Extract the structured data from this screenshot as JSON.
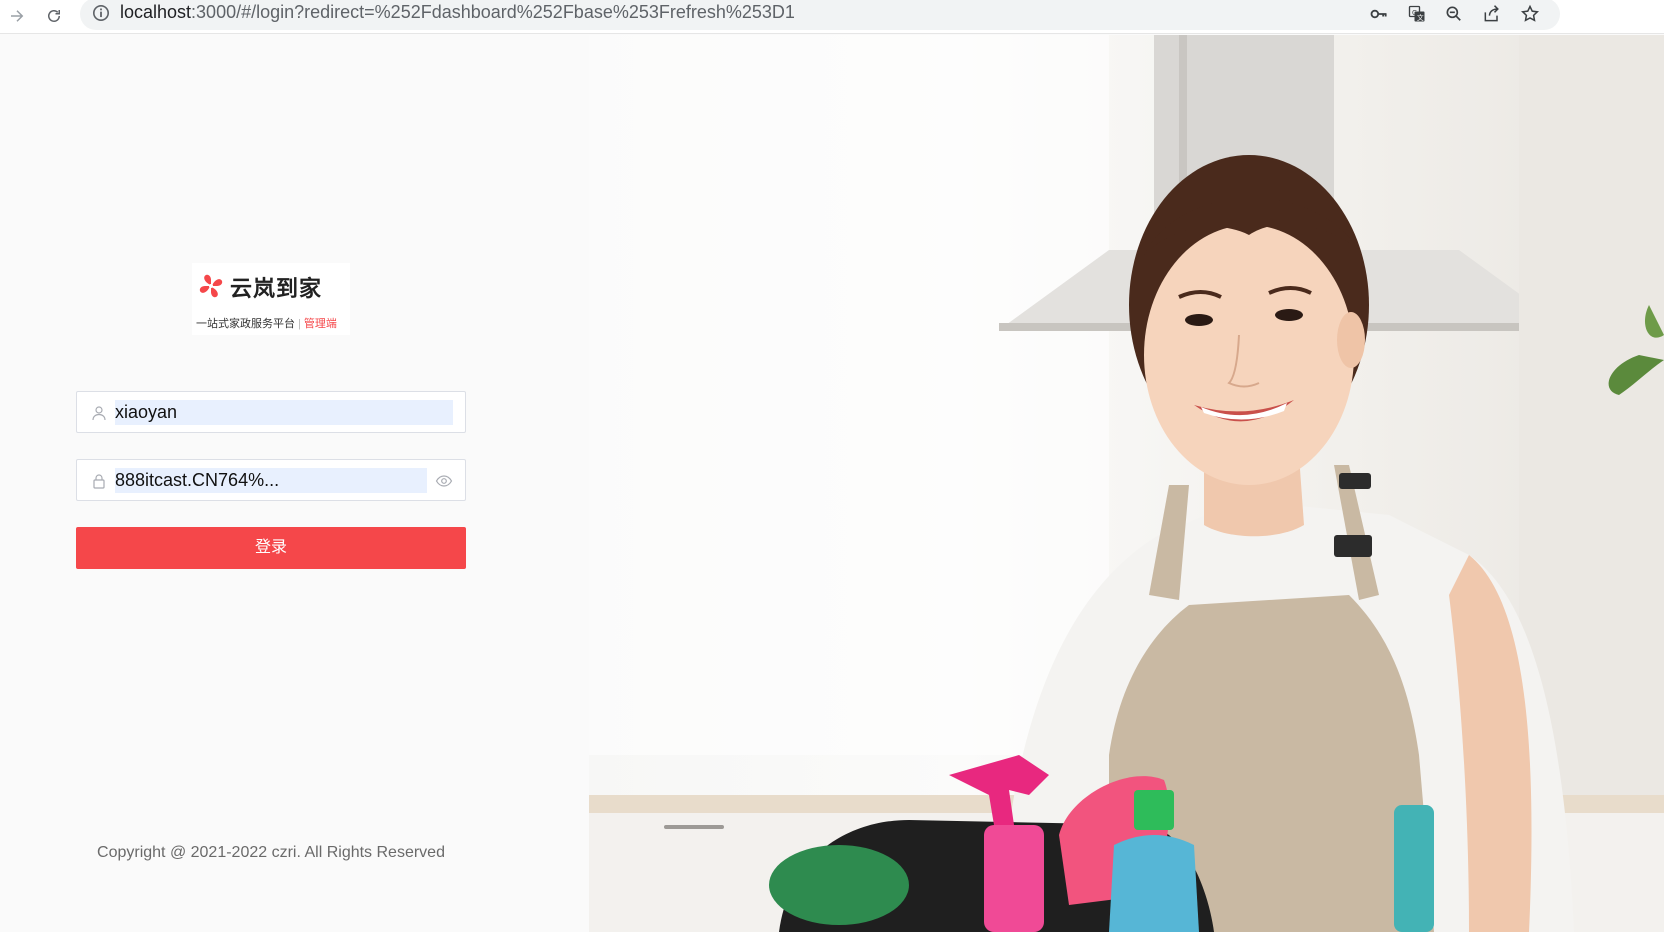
{
  "browser": {
    "url_host": "localhost",
    "url_rest": ":3000/#/login?redirect=%252Fdashboard%252Fbase%253Frefresh%253D1",
    "icons": [
      "forward-icon",
      "reload-icon",
      "info-icon",
      "key-icon",
      "translate-icon",
      "zoom-icon",
      "share-icon",
      "star-icon"
    ]
  },
  "logo": {
    "title": "云岚到家",
    "subtitle": "一站式家政服务平台",
    "separator": "|",
    "role": "管理端",
    "brand_color": "#f5474a"
  },
  "form": {
    "username_value": "xiaoyan",
    "password_value": "888itcast.CN764%...",
    "login_label": "登录",
    "accent_color": "#f5474a"
  },
  "footer": {
    "copyright": "Copyright @ 2021-2022 czri. All Rights Reserved"
  }
}
